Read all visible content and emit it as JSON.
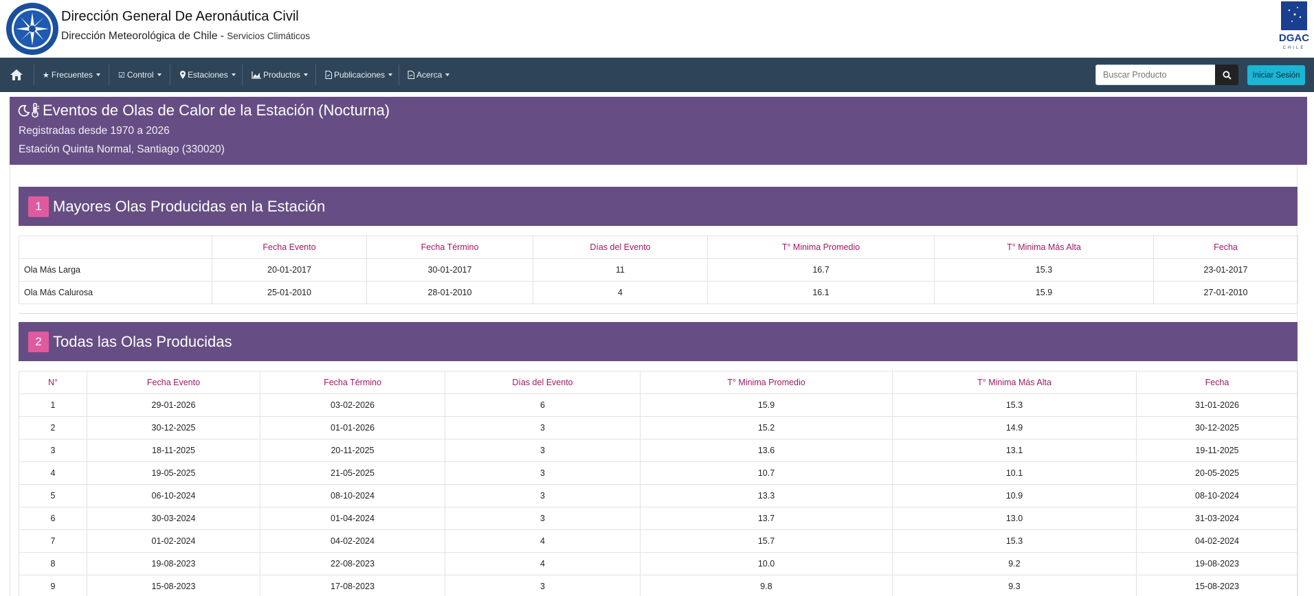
{
  "header": {
    "title": "Dirección General De Aeronáutica Civil",
    "subtitle": "Dirección Meteorológica de Chile",
    "subtitle_dash": " - ",
    "subtitle_small": "Servicios Climáticos",
    "logo_left_icon": "dmc-seal-icon",
    "logo_right_icon": "dgac-logo-icon",
    "logo_right_text": "DGAC"
  },
  "navbar": {
    "home_icon": "home-icon",
    "items": [
      {
        "label": "Frecuentes",
        "icon": "star-icon"
      },
      {
        "label": "Control",
        "icon": "check-square-icon"
      },
      {
        "label": "Estaciones",
        "icon": "map-marker-icon"
      },
      {
        "label": "Productos",
        "icon": "area-chart-icon"
      },
      {
        "label": "Publicaciones",
        "icon": "file-pdf-icon"
      },
      {
        "label": "Acerca",
        "icon": "file-pdf-icon"
      }
    ],
    "search_placeholder": "Buscar Producto",
    "login_label": "Iniciar Sesión"
  },
  "page": {
    "title": "Eventos de Olas de Calor de la Estación (Nocturna)",
    "line1": "Registradas desde 1970 a 2026",
    "line2": "Estación Quinta Normal, Santiago (330020)"
  },
  "section1": {
    "badge": "1",
    "title": "Mayores Olas Producidas en la Estación",
    "columns": [
      "",
      "Fecha Evento",
      "Fecha Término",
      "Días del Evento",
      "T° Minima Promedio",
      "T° Minima Más Alta",
      "Fecha"
    ],
    "rows": [
      [
        "Ola Más Larga",
        "20-01-2017",
        "30-01-2017",
        "11",
        "16.7",
        "15.3",
        "23-01-2017"
      ],
      [
        "Ola Más Calurosa",
        "25-01-2010",
        "28-01-2010",
        "4",
        "16.1",
        "15.9",
        "27-01-2010"
      ]
    ]
  },
  "section2": {
    "badge": "2",
    "title": "Todas las Olas Producidas",
    "columns": [
      "N°",
      "Fecha Evento",
      "Fecha Término",
      "Días del Evento",
      "T° Minima Promedio",
      "T° Minima Más Alta",
      "Fecha"
    ],
    "rows": [
      [
        "1",
        "29-01-2026",
        "03-02-2026",
        "6",
        "15.9",
        "15.3",
        "31-01-2026"
      ],
      [
        "2",
        "30-12-2025",
        "01-01-2026",
        "3",
        "15.2",
        "14.9",
        "30-12-2025"
      ],
      [
        "3",
        "18-11-2025",
        "20-11-2025",
        "3",
        "13.6",
        "13.1",
        "19-11-2025"
      ],
      [
        "4",
        "19-05-2025",
        "21-05-2025",
        "3",
        "10.7",
        "10.1",
        "20-05-2025"
      ],
      [
        "5",
        "06-10-2024",
        "08-10-2024",
        "3",
        "13.3",
        "10.9",
        "08-10-2024"
      ],
      [
        "6",
        "30-03-2024",
        "01-04-2024",
        "3",
        "13.7",
        "13.0",
        "31-03-2024"
      ],
      [
        "7",
        "01-02-2024",
        "04-02-2024",
        "4",
        "15.7",
        "15.3",
        "04-02-2024"
      ],
      [
        "8",
        "19-08-2023",
        "22-08-2023",
        "4",
        "10.0",
        "9.2",
        "19-08-2023"
      ],
      [
        "9",
        "15-08-2023",
        "17-08-2023",
        "3",
        "9.8",
        "9.3",
        "15-08-2023"
      ]
    ]
  },
  "colors": {
    "navbar": "#2e4559",
    "band": "#664e84",
    "badge": "#e05aa0",
    "header_text": "#a11764",
    "login": "#1ab6d4"
  }
}
